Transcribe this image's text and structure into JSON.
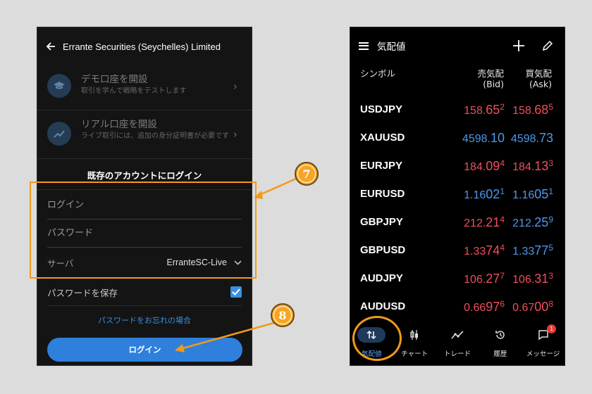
{
  "left": {
    "title": "Errante Securities (Seychelles) Limited",
    "rows": [
      {
        "title": "デモ口座を開設",
        "sub": "取引を学んで戦略をテストします"
      },
      {
        "title": "リアル口座を開設",
        "sub": "ライブ取引には、追加の身分証明書が必要です"
      }
    ],
    "existing_heading": "既存のアカウントにログイン",
    "login_placeholder": "ログイン",
    "password_placeholder": "パスワード",
    "server_label": "サーバ",
    "server_value": "ErranteSC-Live",
    "save_password": "パスワードを保存",
    "forgot": "パスワードをお忘れの場合",
    "login_button": "ログイン"
  },
  "callouts": {
    "seven": "7",
    "eight": "8"
  },
  "right": {
    "title": "気配値",
    "col_symbol": "シンボル",
    "col_bid": "売気配",
    "col_bid_sub": "(Bid)",
    "col_ask": "買気配",
    "col_ask_sub": "(Ask)",
    "quotes": [
      {
        "symbol": "USDJPY",
        "bid_a": "158.",
        "bid_b": "65",
        "bid_c": "2",
        "ask_a": "158.",
        "ask_b": "68",
        "ask_c": "5",
        "dir": "down"
      },
      {
        "symbol": "XAUUSD",
        "bid_a": "4598.",
        "bid_b": "10",
        "bid_c": "",
        "ask_a": "4598.",
        "ask_b": "73",
        "ask_c": "",
        "dir": "up"
      },
      {
        "symbol": "EURJPY",
        "bid_a": "184.",
        "bid_b": "09",
        "bid_c": "4",
        "ask_a": "184.",
        "ask_b": "13",
        "ask_c": "3",
        "dir": "down"
      },
      {
        "symbol": "EURUSD",
        "bid_a": "1.16",
        "bid_b": "02",
        "bid_c": "1",
        "ask_a": "1.16",
        "ask_b": "05",
        "ask_c": "1",
        "dir": "up"
      },
      {
        "symbol": "GBPJPY",
        "bid_a": "212.",
        "bid_b": "21",
        "bid_c": "4",
        "ask_a": "212.",
        "ask_b": "25",
        "ask_c": "9",
        "dir": "mixed"
      },
      {
        "symbol": "GBPUSD",
        "bid_a": "1.33",
        "bid_b": "74",
        "bid_c": "4",
        "ask_a": "1.33",
        "ask_b": "77",
        "ask_c": "5",
        "dir": "mixed"
      },
      {
        "symbol": "AUDJPY",
        "bid_a": "106.",
        "bid_b": "27",
        "bid_c": "7",
        "ask_a": "106.",
        "ask_b": "31",
        "ask_c": "3",
        "dir": "down"
      },
      {
        "symbol": "AUDUSD",
        "bid_a": "0.66",
        "bid_b": "97",
        "bid_c": "6",
        "ask_a": "0.67",
        "ask_b": "00",
        "ask_c": "8",
        "dir": "down"
      }
    ],
    "tabs": [
      {
        "label": "気配値",
        "icon": "arrows-up-down-icon"
      },
      {
        "label": "チャート",
        "icon": "candlestick-icon"
      },
      {
        "label": "トレード",
        "icon": "trend-line-icon"
      },
      {
        "label": "履歴",
        "icon": "history-icon"
      },
      {
        "label": "メッセージ",
        "icon": "message-icon"
      }
    ],
    "badge": "1"
  },
  "colors": {
    "accent": "#2e80dc",
    "orange": "#f29a1a",
    "up": "#4f98ea",
    "down": "#ef4e5e"
  }
}
